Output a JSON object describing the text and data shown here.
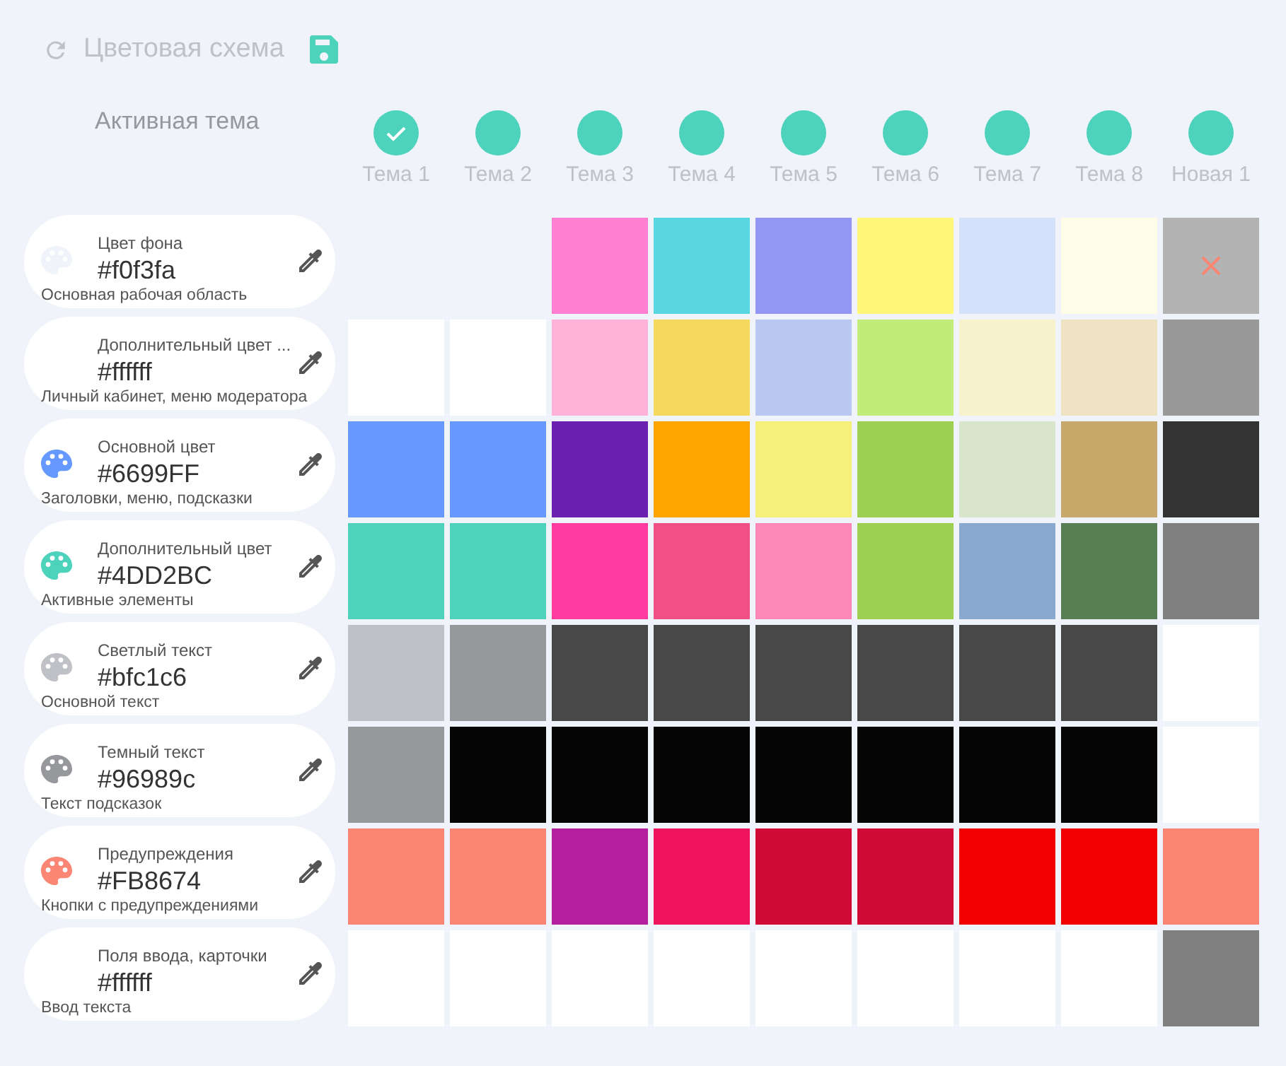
{
  "header": {
    "title": "Цветовая схема"
  },
  "active_theme_label": "Активная тема",
  "themes": [
    {
      "name": "Тема 1",
      "selected": true,
      "deletable": false
    },
    {
      "name": "Тема 2",
      "selected": false,
      "deletable": false
    },
    {
      "name": "Тема 3",
      "selected": false,
      "deletable": false
    },
    {
      "name": "Тема 4",
      "selected": false,
      "deletable": false
    },
    {
      "name": "Тема 5",
      "selected": false,
      "deletable": false
    },
    {
      "name": "Тема 6",
      "selected": false,
      "deletable": false
    },
    {
      "name": "Тема 7",
      "selected": false,
      "deletable": false
    },
    {
      "name": "Тема 8",
      "selected": false,
      "deletable": false
    },
    {
      "name": "Новая 1",
      "selected": false,
      "deletable": true
    }
  ],
  "rows": [
    {
      "label": "Цвет фона",
      "hex": "#f0f3fa",
      "description": "Основная рабочая область",
      "color": "#f0f3fa",
      "swatches": [
        {
          "kind": "blank"
        },
        {
          "kind": "blank"
        },
        {
          "color": "#ff80d0"
        },
        {
          "color": "#5ad6e0"
        },
        {
          "color": "#9296f5"
        },
        {
          "color": "#fff67a"
        },
        {
          "color": "#d5e0fa"
        },
        {
          "color": "#fffde8"
        },
        {
          "color": "#b3b3b3"
        }
      ]
    },
    {
      "label": "Дополнительный цвет ...",
      "hex": "#ffffff",
      "description": "Личный кабинет, меню модератора",
      "swatches": [
        {
          "color": "#ffffff"
        },
        {
          "color": "#ffffff"
        },
        {
          "color": "#ffb3d9"
        },
        {
          "color": "#f5d95c"
        },
        {
          "color": "#b8c8f0"
        },
        {
          "color": "#c2ec7a"
        },
        {
          "color": "#f5f2cc"
        },
        {
          "color": "#f0e3c4"
        },
        {
          "color": "#999999"
        }
      ]
    },
    {
      "label": "Основной цвет",
      "hex": "#6699FF",
      "description": "Заголовки, меню, подсказки",
      "color": "#6699ff",
      "swatches": [
        {
          "color": "#6699ff"
        },
        {
          "color": "#6699ff"
        },
        {
          "color": "#6a1fb0"
        },
        {
          "color": "#ffa500"
        },
        {
          "color": "#f5f07a"
        },
        {
          "color": "#9ccf52"
        },
        {
          "color": "#d8e4cc"
        },
        {
          "color": "#c7a86a"
        },
        {
          "color": "#333333"
        }
      ]
    },
    {
      "label": "Дополнительный цвет",
      "hex": "#4DD2BC",
      "description": "Активные элементы",
      "color": "#4dd2bc",
      "swatches": [
        {
          "color": "#4dd2bc"
        },
        {
          "color": "#4dd2bc"
        },
        {
          "color": "#ff3ba0"
        },
        {
          "color": "#f24f86"
        },
        {
          "color": "#fc88b8"
        },
        {
          "color": "#9ccf52"
        },
        {
          "color": "#8aa9cf"
        },
        {
          "color": "#587f53"
        },
        {
          "color": "#808080"
        }
      ]
    },
    {
      "label": "Светлый текст",
      "hex": "#bfc1c6",
      "description": "Основной текст",
      "color": "#bfc1c6",
      "swatches": [
        {
          "color": "#bfc1c6"
        },
        {
          "color": "#96989c"
        },
        {
          "color": "#484848"
        },
        {
          "color": "#484848"
        },
        {
          "color": "#484848"
        },
        {
          "color": "#484848"
        },
        {
          "color": "#484848"
        },
        {
          "color": "#484848"
        },
        {
          "color": "#ffffff"
        }
      ]
    },
    {
      "label": "Темный текст",
      "hex": "#96989c",
      "description": "Текст подсказок",
      "color": "#96989c",
      "swatches": [
        {
          "color": "#96989c"
        },
        {
          "color": "#050505"
        },
        {
          "color": "#050505"
        },
        {
          "color": "#050505"
        },
        {
          "color": "#050505"
        },
        {
          "color": "#050505"
        },
        {
          "color": "#050505"
        },
        {
          "color": "#050505"
        },
        {
          "color": "#ffffff"
        }
      ]
    },
    {
      "label": "Предупреждения",
      "hex": "#FB8674",
      "description": "Кнопки с предупреждениями",
      "color": "#fb8674",
      "swatches": [
        {
          "color": "#fb8674"
        },
        {
          "color": "#fb8674"
        },
        {
          "color": "#b31f9e"
        },
        {
          "color": "#f0145e"
        },
        {
          "color": "#cf0a35"
        },
        {
          "color": "#cf0a35"
        },
        {
          "color": "#f00000"
        },
        {
          "color": "#f00000"
        },
        {
          "color": "#fb8674"
        }
      ]
    },
    {
      "label": "Поля ввода, карточки",
      "hex": "#ffffff",
      "description": "Ввод текста",
      "swatches": [
        {
          "color": "#ffffff"
        },
        {
          "color": "#ffffff"
        },
        {
          "color": "#ffffff"
        },
        {
          "color": "#ffffff"
        },
        {
          "color": "#ffffff"
        },
        {
          "color": "#ffffff"
        },
        {
          "color": "#ffffff"
        },
        {
          "color": "#ffffff"
        },
        {
          "color": "#808080"
        }
      ]
    }
  ]
}
